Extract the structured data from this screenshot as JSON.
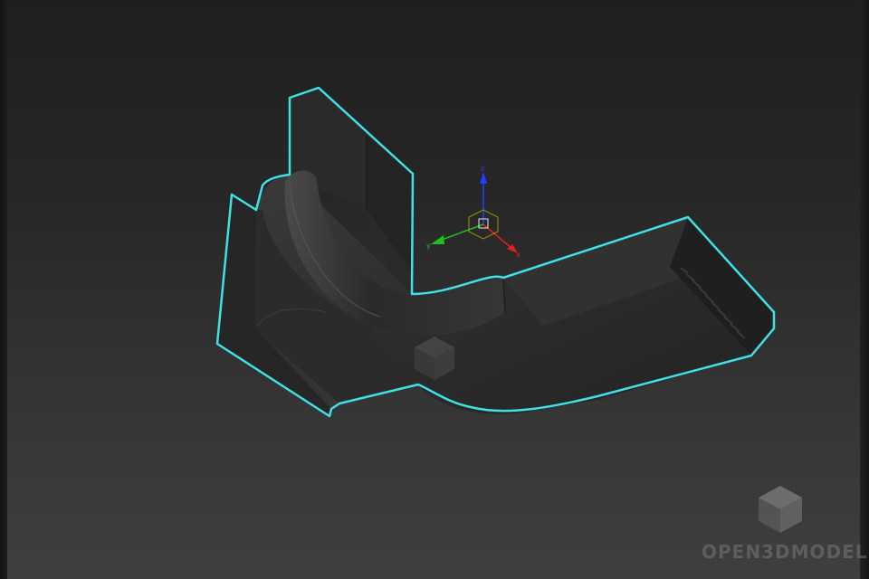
{
  "viewport": {
    "background_top": "#1f1f1f",
    "background_bottom": "#3f3f3f",
    "selection_outline_color": "#3fe0e6",
    "object_color": "#2e2e2e"
  },
  "gizmo": {
    "x_label": "x",
    "y_label": "y",
    "z_label": "z",
    "x_color": "#e02020",
    "y_color": "#20c020",
    "z_color": "#2040ff"
  },
  "watermark": {
    "text": "OPEN3DMODEL",
    "icon": "cube-logo-icon"
  }
}
